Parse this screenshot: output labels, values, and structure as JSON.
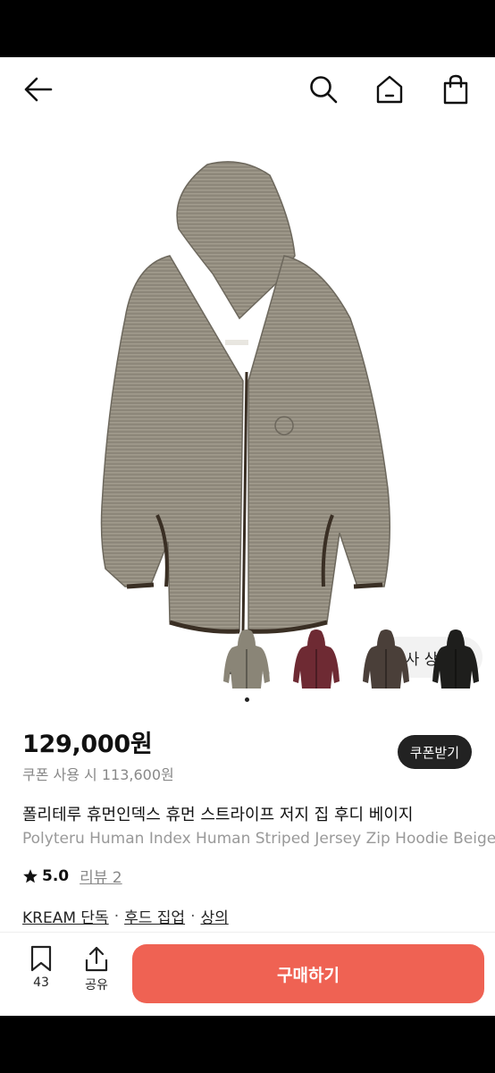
{
  "header": {
    "back_icon": "arrow-left-icon",
    "search_icon": "search-icon",
    "home_icon": "home-icon",
    "cart_icon": "shopping-bag-icon"
  },
  "hero": {
    "similar_label": "유사 상품",
    "similar_icon": "chevron-right-icon"
  },
  "thumbnails": [
    {
      "color": "#8a8577"
    },
    {
      "color": "#6e2a33"
    },
    {
      "color": "#4a3f39"
    },
    {
      "color": "#1e1e1c"
    }
  ],
  "product": {
    "price": "129,000원",
    "coupon_price_text": "쿠폰 사용 시 113,600원",
    "coupon_button": "쿠폰받기",
    "title_ko": "폴리테루 휴먼인덱스 휴먼 스트라이프 저지 집 후디 베이지",
    "title_en": "Polyteru Human Index Human Striped Jersey Zip Hoodie Beige",
    "rating": "5.0",
    "review_link": "리뷰 2",
    "categories": [
      "KREAM 단독",
      "후드 집업",
      "상의"
    ],
    "category_sep": "·"
  },
  "bottom_bar": {
    "bookmark_count": "43",
    "share_label": "공유",
    "buy_label": "구매하기"
  },
  "colors": {
    "accent": "#ef6253",
    "dark": "#222222"
  }
}
